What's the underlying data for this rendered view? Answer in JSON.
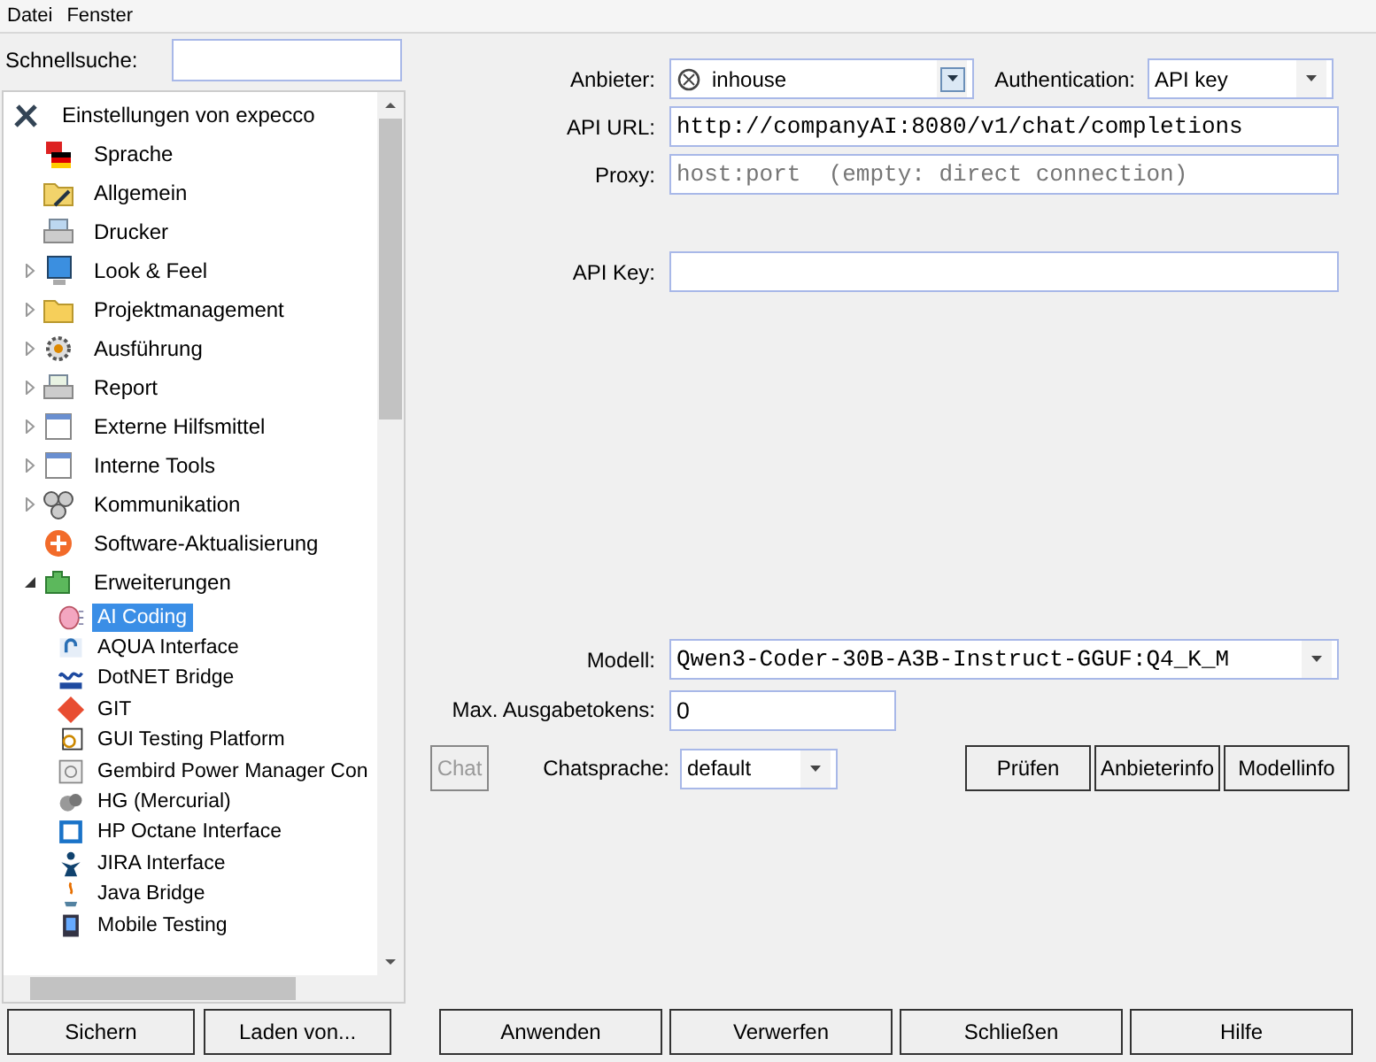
{
  "menu": [
    "Datei",
    "Fenster"
  ],
  "search": {
    "label": "Schnellsuche:"
  },
  "tree": {
    "label": "Einstellungen von expecco",
    "selected": false,
    "children": [
      {
        "label": "Sprache",
        "selected": false
      },
      {
        "label": "Allgemein",
        "selected": false
      },
      {
        "label": "Drucker",
        "selected": false
      },
      {
        "label": "Look & Feel",
        "expanded": false,
        "selected": false
      },
      {
        "label": "Projektmanagement",
        "expanded": false,
        "selected": false
      },
      {
        "label": "Ausführung",
        "expanded": false,
        "selected": false
      },
      {
        "label": "Report",
        "expanded": false,
        "selected": false
      },
      {
        "label": "Externe Hilfsmittel",
        "expanded": false,
        "selected": false
      },
      {
        "label": "Interne Tools",
        "expanded": false,
        "selected": false
      },
      {
        "label": "Kommunikation",
        "expanded": false,
        "selected": false
      },
      {
        "label": "Software-Aktualisierung",
        "selected": false
      },
      {
        "label": "Erweiterungen",
        "expanded": true,
        "selected": false,
        "children": [
          {
            "label": "AI Coding",
            "selected": true
          },
          {
            "label": "AQUA Interface",
            "selected": false
          },
          {
            "label": "DotNET Bridge",
            "selected": false
          },
          {
            "label": "GIT",
            "selected": false
          },
          {
            "label": "GUI Testing Platform",
            "selected": false
          },
          {
            "label": "Gembird Power Manager Con",
            "selected": false
          },
          {
            "label": "HG (Mercurial)",
            "selected": false
          },
          {
            "label": "HP Octane Interface",
            "selected": false
          },
          {
            "label": "JIRA Interface",
            "selected": false
          },
          {
            "label": "Java Bridge",
            "selected": false
          },
          {
            "label": "Mobile Testing",
            "selected": false
          }
        ]
      }
    ]
  },
  "left_buttons": [
    "Sichern",
    "Laden von..."
  ],
  "form": {
    "provider": {
      "label": "Anbieter:",
      "value": "inhouse"
    },
    "authentication": {
      "label": "Authentication:",
      "value": "API key"
    },
    "api_url": {
      "label": "API URL:",
      "value": "http://companyAI:8080/v1/chat/completions"
    },
    "proxy": {
      "label": "Proxy:",
      "placeholder": "host:port  (empty: direct connection)"
    },
    "api_key": {
      "label": "API Key:"
    },
    "model": {
      "label": "Modell:",
      "value": "Qwen3-Coder-30B-A3B-Instruct-GGUF:Q4_K_M"
    },
    "max_tokens": {
      "label": "Max. Ausgabetokens:",
      "value": "0"
    },
    "chat_button": {
      "label": "Chat",
      "disabled": true
    },
    "chat_language": {
      "label": "Chatsprache:",
      "value": "default"
    },
    "action_buttons": [
      "Prüfen",
      "Anbieterinfo",
      "Modellinfo"
    ]
  },
  "bottom_buttons": [
    "Anwenden",
    "Verwerfen",
    "Schließen",
    "Hilfe"
  ]
}
